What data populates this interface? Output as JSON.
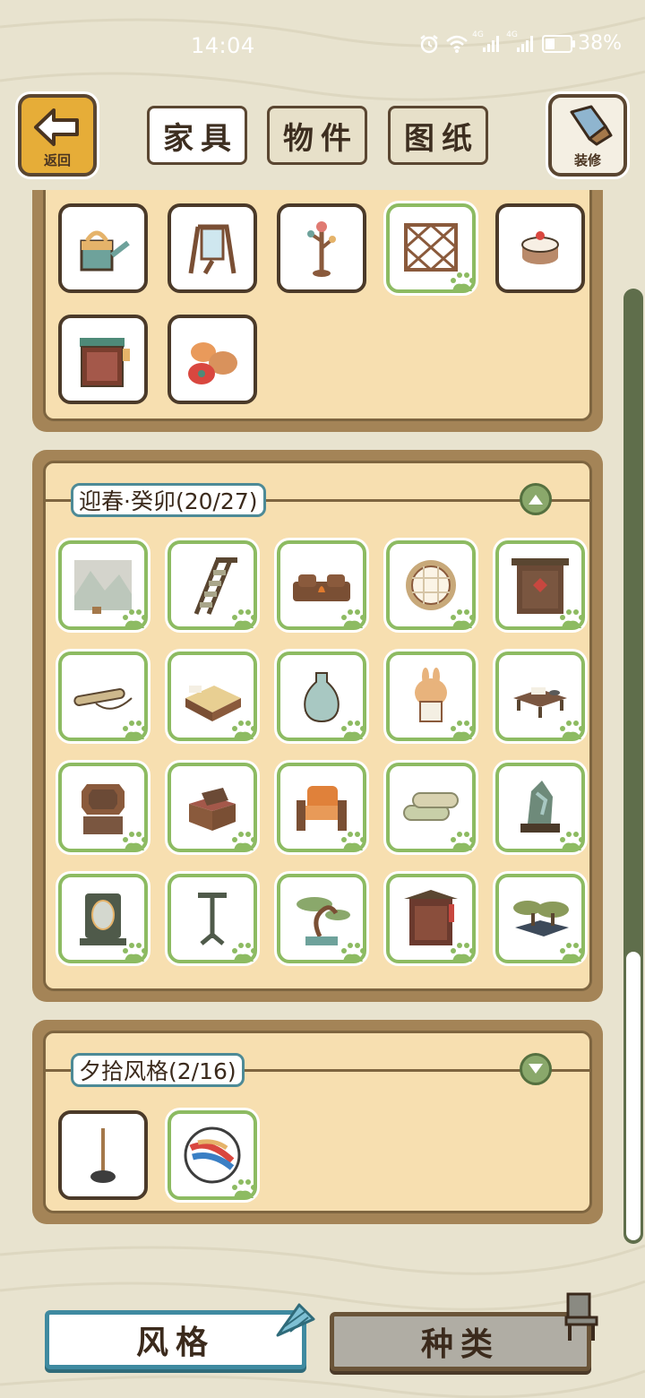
{
  "status_bar": {
    "time": "14:04",
    "network_label_1": "4G",
    "network_label_2": "4G",
    "battery": "38%",
    "icons": [
      "alarm-icon",
      "wifi-icon",
      "signal-icon",
      "signal-icon",
      "battery-icon"
    ]
  },
  "header": {
    "back_label": "返回",
    "decorate_label": "装修",
    "tabs": [
      {
        "label": "家具",
        "active": true
      },
      {
        "label": "物件",
        "active": false
      },
      {
        "label": "图纸",
        "active": false
      }
    ]
  },
  "groups": [
    {
      "title": "",
      "items": [
        {
          "icon": "watering-can-icon",
          "state": "owned"
        },
        {
          "icon": "standing-mirror-icon",
          "state": "owned"
        },
        {
          "icon": "coat-rack-icon",
          "state": "owned"
        },
        {
          "icon": "lattice-screen-icon",
          "state": "new"
        },
        {
          "icon": "cake-icon",
          "state": "owned"
        },
        {
          "icon": "cabinet-icon",
          "state": "owned"
        },
        {
          "icon": "sacks-icon",
          "state": "owned"
        }
      ]
    },
    {
      "title": "迎春·癸卯(20/27)",
      "expanded": true,
      "items": [
        {
          "icon": "landscape-painting-icon",
          "state": "new"
        },
        {
          "icon": "ladder-icon",
          "state": "new"
        },
        {
          "icon": "log-fire-icon",
          "state": "new"
        },
        {
          "icon": "round-window-icon",
          "state": "new"
        },
        {
          "icon": "wooden-door-icon",
          "state": "new"
        },
        {
          "icon": "scroll-icon",
          "state": "new"
        },
        {
          "icon": "bed-icon",
          "state": "new"
        },
        {
          "icon": "vase-icon",
          "state": "new"
        },
        {
          "icon": "rabbit-calendar-icon",
          "state": "new"
        },
        {
          "icon": "low-table-icon",
          "state": "new"
        },
        {
          "icon": "dresser-mirror-icon",
          "state": "new"
        },
        {
          "icon": "chest-icon",
          "state": "new"
        },
        {
          "icon": "armchair-icon",
          "state": "new"
        },
        {
          "icon": "fabric-rolls-icon",
          "state": "new"
        },
        {
          "icon": "rockery-icon",
          "state": "new"
        },
        {
          "icon": "mirror-stand-icon",
          "state": "new"
        },
        {
          "icon": "stand-icon",
          "state": "new"
        },
        {
          "icon": "bonsai-icon",
          "state": "new"
        },
        {
          "icon": "shrine-cabinet-icon",
          "state": "new"
        },
        {
          "icon": "bonsai-tray-icon",
          "state": "new"
        }
      ]
    },
    {
      "title": "夕拾风格(2/16)",
      "expanded": false,
      "items": [
        {
          "icon": "pole-stand-icon",
          "state": "owned"
        },
        {
          "icon": "marble-icon",
          "state": "new"
        }
      ]
    }
  ],
  "bottom_bar": {
    "style_label": "风格",
    "type_label": "种类"
  },
  "colors": {
    "background": "#e8e3cf",
    "panel": "#f7dfb0",
    "frame": "#a48457",
    "new_border": "#8dbb62",
    "accent_teal": "#3f8aa0",
    "scrollbar": "#5f6e4b"
  }
}
